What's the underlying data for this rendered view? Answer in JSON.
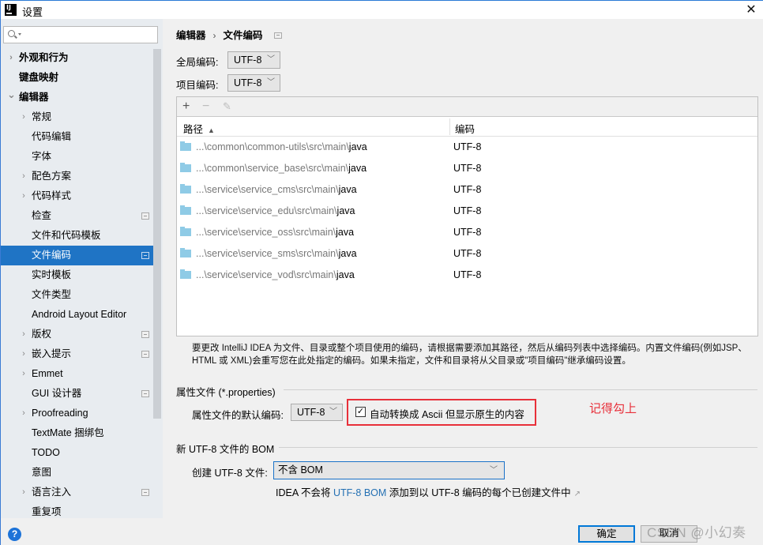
{
  "window": {
    "title": "设置",
    "app_icon": "intellij-icon",
    "close_icon": "close-icon"
  },
  "sidebar": {
    "search_placeholder": "",
    "items": [
      {
        "label": "外观和行为",
        "level": 0,
        "arrow": "right",
        "bold": true,
        "badge": false,
        "selected": false
      },
      {
        "label": "键盘映射",
        "level": 0,
        "arrow": "",
        "bold": true,
        "badge": false,
        "selected": false
      },
      {
        "label": "编辑器",
        "level": 0,
        "arrow": "down",
        "bold": true,
        "badge": false,
        "selected": false
      },
      {
        "label": "常规",
        "level": 1,
        "arrow": "right",
        "bold": false,
        "badge": false,
        "selected": false
      },
      {
        "label": "代码编辑",
        "level": 1,
        "arrow": "",
        "bold": false,
        "badge": false,
        "selected": false
      },
      {
        "label": "字体",
        "level": 1,
        "arrow": "",
        "bold": false,
        "badge": false,
        "selected": false
      },
      {
        "label": "配色方案",
        "level": 1,
        "arrow": "right",
        "bold": false,
        "badge": false,
        "selected": false
      },
      {
        "label": "代码样式",
        "level": 1,
        "arrow": "right",
        "bold": false,
        "badge": false,
        "selected": false
      },
      {
        "label": "检查",
        "level": 1,
        "arrow": "",
        "bold": false,
        "badge": true,
        "selected": false
      },
      {
        "label": "文件和代码模板",
        "level": 1,
        "arrow": "",
        "bold": false,
        "badge": false,
        "selected": false
      },
      {
        "label": "文件编码",
        "level": 1,
        "arrow": "",
        "bold": false,
        "badge": true,
        "selected": true
      },
      {
        "label": "实时模板",
        "level": 1,
        "arrow": "",
        "bold": false,
        "badge": false,
        "selected": false
      },
      {
        "label": "文件类型",
        "level": 1,
        "arrow": "",
        "bold": false,
        "badge": false,
        "selected": false
      },
      {
        "label": "Android Layout Editor",
        "level": 1,
        "arrow": "",
        "bold": false,
        "badge": false,
        "selected": false
      },
      {
        "label": "版权",
        "level": 1,
        "arrow": "right",
        "bold": false,
        "badge": true,
        "selected": false
      },
      {
        "label": "嵌入提示",
        "level": 1,
        "arrow": "right",
        "bold": false,
        "badge": true,
        "selected": false
      },
      {
        "label": "Emmet",
        "level": 1,
        "arrow": "right",
        "bold": false,
        "badge": false,
        "selected": false
      },
      {
        "label": "GUI 设计器",
        "level": 1,
        "arrow": "",
        "bold": false,
        "badge": true,
        "selected": false
      },
      {
        "label": "Proofreading",
        "level": 1,
        "arrow": "right",
        "bold": false,
        "badge": false,
        "selected": false
      },
      {
        "label": "TextMate 捆绑包",
        "level": 1,
        "arrow": "",
        "bold": false,
        "badge": false,
        "selected": false
      },
      {
        "label": "TODO",
        "level": 1,
        "arrow": "",
        "bold": false,
        "badge": false,
        "selected": false
      },
      {
        "label": "意图",
        "level": 1,
        "arrow": "",
        "bold": false,
        "badge": false,
        "selected": false
      },
      {
        "label": "语言注入",
        "level": 1,
        "arrow": "right",
        "bold": false,
        "badge": true,
        "selected": false
      },
      {
        "label": "重复项",
        "level": 1,
        "arrow": "",
        "bold": false,
        "badge": false,
        "selected": false
      }
    ],
    "help_label": "?"
  },
  "breadcrumb": {
    "parent": "编辑器",
    "separator": "›",
    "current": "文件编码"
  },
  "global_encoding": {
    "label": "全局编码:",
    "value": "UTF-8"
  },
  "project_encoding": {
    "label": "项目编码:",
    "value": "UTF-8"
  },
  "table": {
    "toolbar": {
      "add": "+",
      "remove": "−",
      "edit": "✎"
    },
    "columns": {
      "path": "路径",
      "sort_indicator": "▲",
      "encoding": "编码"
    },
    "rows": [
      {
        "prefix": "...\\common\\common-utils\\src\\main\\",
        "leaf": "java",
        "encoding": "UTF-8"
      },
      {
        "prefix": "...\\common\\service_base\\src\\main\\",
        "leaf": "java",
        "encoding": "UTF-8"
      },
      {
        "prefix": "...\\service\\service_cms\\src\\main\\",
        "leaf": "java",
        "encoding": "UTF-8"
      },
      {
        "prefix": "...\\service\\service_edu\\src\\main\\",
        "leaf": "java",
        "encoding": "UTF-8"
      },
      {
        "prefix": "...\\service\\service_oss\\src\\main\\",
        "leaf": "java",
        "encoding": "UTF-8"
      },
      {
        "prefix": "...\\service\\service_sms\\src\\main\\",
        "leaf": "java",
        "encoding": "UTF-8"
      },
      {
        "prefix": "...\\service\\service_vod\\src\\main\\",
        "leaf": "java",
        "encoding": "UTF-8"
      }
    ]
  },
  "info_text": "要更改 IntelliJ IDEA 为文件、目录或整个项目使用的编码，请根据需要添加其路径，然后从编码列表中选择编码。内置文件编码(例如JSP、HTML 或 XML)会重写您在此处指定的编码。如果未指定，文件和目录将从父目录或\"项目编码\"继承编码设置。",
  "properties": {
    "group_title": "属性文件 (*.properties)",
    "default_label": "属性文件的默认编码:",
    "default_value": "UTF-8",
    "transparent_checkbox": {
      "label": "自动转换成 Ascii 但显示原生的内容",
      "checked": true
    }
  },
  "annotation": {
    "text": "记得勾上",
    "color": "#e8303a"
  },
  "bom": {
    "group_title": "新 UTF-8 文件的 BOM",
    "create_label": "创建 UTF-8 文件:",
    "create_value": "不含 BOM",
    "note_prefix": "IDEA 不会将 ",
    "note_link": "UTF-8 BOM",
    "note_suffix": " 添加到以 UTF-8 编码的每个已创建文件中",
    "note_ext": "↗"
  },
  "footer": {
    "ok_label": "确定",
    "cancel_label": "取消",
    "watermark": "CSDN @小幻奏"
  },
  "colors": {
    "selection": "#1f74c5",
    "link": "#2470b3",
    "highlight_box": "#e8303a",
    "sidebar_bg": "#e8ecf0"
  }
}
